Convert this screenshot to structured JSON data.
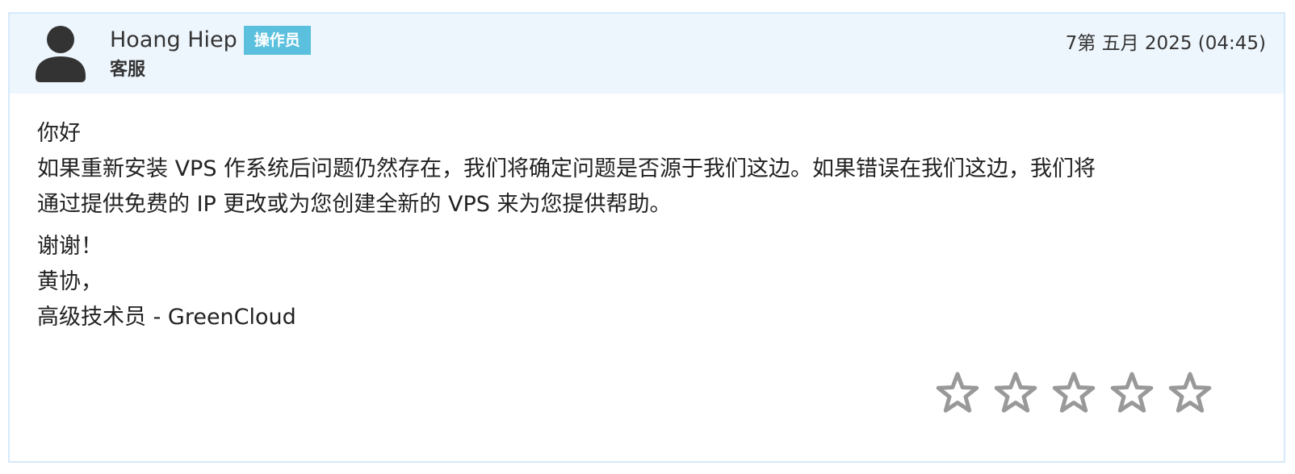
{
  "reply": {
    "author_name": "Hoang Hiep",
    "role_badge": "操作员",
    "department": "客服",
    "timestamp": "7第 五月 2025 (04:45)",
    "message": {
      "greeting": "你好",
      "body_lines": [
        "如果重新安装 VPS 作系统后问题仍然存在，我们将确定问题是否源于我们这边。如果错误在我们这边，我们将",
        "通过提供免费的 IP 更改或为您创建全新的 VPS 来为您提供帮助。"
      ],
      "thanks": "谢谢！",
      "signature_name": "黄协，",
      "signature_title": "高级技术员 - GreenCloud"
    },
    "rating": {
      "value": 0,
      "max": 5,
      "icon": "star-outline-icon"
    }
  },
  "colors": {
    "header_bg": "#eef6fd",
    "card_border": "#d6e9fa",
    "badge_bg": "#5bc0de",
    "avatar": "#333333",
    "star_outline": "#999999"
  }
}
